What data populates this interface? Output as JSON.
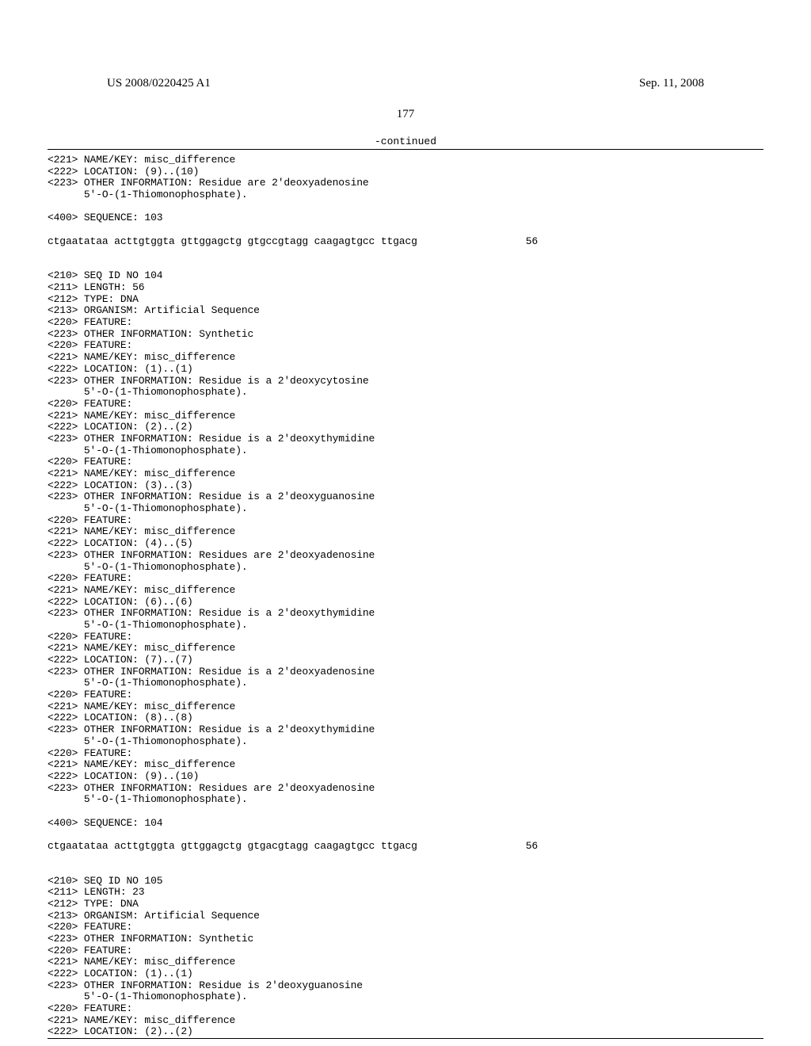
{
  "header": {
    "left": "US 2008/0220425 A1",
    "right": "Sep. 11, 2008"
  },
  "page_number": "177",
  "continued_label": "-continued",
  "seq": {
    "block1": [
      "<221> NAME/KEY: misc_difference",
      "<222> LOCATION: (9)..(10)",
      "<223> OTHER INFORMATION: Residue are 2'deoxyadenosine",
      "      5'-O-(1-Thiomonophosphate)."
    ],
    "seq103_header": "<400> SEQUENCE: 103",
    "seq103_line": "ctgaatataa acttgtggta gttggagctg gtgccgtagg caagagtgcc ttgacg",
    "seq103_num": "56",
    "block2": [
      "<210> SEQ ID NO 104",
      "<211> LENGTH: 56",
      "<212> TYPE: DNA",
      "<213> ORGANISM: Artificial Sequence",
      "<220> FEATURE:",
      "<223> OTHER INFORMATION: Synthetic",
      "<220> FEATURE:",
      "<221> NAME/KEY: misc_difference",
      "<222> LOCATION: (1)..(1)",
      "<223> OTHER INFORMATION: Residue is a 2'deoxycytosine",
      "      5'-O-(1-Thiomonophosphate).",
      "<220> FEATURE:",
      "<221> NAME/KEY: misc_difference",
      "<222> LOCATION: (2)..(2)",
      "<223> OTHER INFORMATION: Residue is a 2'deoxythymidine",
      "      5'-O-(1-Thiomonophosphate).",
      "<220> FEATURE:",
      "<221> NAME/KEY: misc_difference",
      "<222> LOCATION: (3)..(3)",
      "<223> OTHER INFORMATION: Residue is a 2'deoxyguanosine",
      "      5'-O-(1-Thiomonophosphate).",
      "<220> FEATURE:",
      "<221> NAME/KEY: misc_difference",
      "<222> LOCATION: (4)..(5)",
      "<223> OTHER INFORMATION: Residues are 2'deoxyadenosine",
      "      5'-O-(1-Thiomonophosphate).",
      "<220> FEATURE:",
      "<221> NAME/KEY: misc_difference",
      "<222> LOCATION: (6)..(6)",
      "<223> OTHER INFORMATION: Residue is a 2'deoxythymidine",
      "      5'-O-(1-Thiomonophosphate).",
      "<220> FEATURE:",
      "<221> NAME/KEY: misc_difference",
      "<222> LOCATION: (7)..(7)",
      "<223> OTHER INFORMATION: Residue is a 2'deoxyadenosine",
      "      5'-O-(1-Thiomonophosphate).",
      "<220> FEATURE:",
      "<221> NAME/KEY: misc_difference",
      "<222> LOCATION: (8)..(8)",
      "<223> OTHER INFORMATION: Residue is a 2'deoxythymidine",
      "      5'-O-(1-Thiomonophosphate).",
      "<220> FEATURE:",
      "<221> NAME/KEY: misc_difference",
      "<222> LOCATION: (9)..(10)",
      "<223> OTHER INFORMATION: Residues are 2'deoxyadenosine",
      "      5'-O-(1-Thiomonophosphate)."
    ],
    "seq104_header": "<400> SEQUENCE: 104",
    "seq104_line": "ctgaatataa acttgtggta gttggagctg gtgacgtagg caagagtgcc ttgacg",
    "seq104_num": "56",
    "block3": [
      "<210> SEQ ID NO 105",
      "<211> LENGTH: 23",
      "<212> TYPE: DNA",
      "<213> ORGANISM: Artificial Sequence",
      "<220> FEATURE:",
      "<223> OTHER INFORMATION: Synthetic",
      "<220> FEATURE:",
      "<221> NAME/KEY: misc_difference",
      "<222> LOCATION: (1)..(1)",
      "<223> OTHER INFORMATION: Residue is 2'deoxyguanosine",
      "      5'-O-(1-Thiomonophosphate).",
      "<220> FEATURE:",
      "<221> NAME/KEY: misc_difference",
      "<222> LOCATION: (2)..(2)"
    ]
  }
}
